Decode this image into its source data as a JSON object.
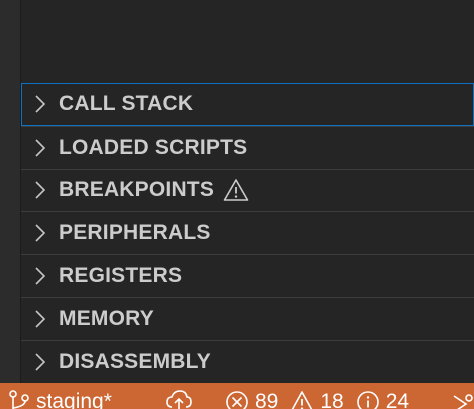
{
  "sidebar": {
    "sections": [
      {
        "label": "CALL STACK",
        "focused": true,
        "warning": false
      },
      {
        "label": "LOADED SCRIPTS",
        "focused": false,
        "warning": false
      },
      {
        "label": "BREAKPOINTS",
        "focused": false,
        "warning": true
      },
      {
        "label": "PERIPHERALS",
        "focused": false,
        "warning": false
      },
      {
        "label": "REGISTERS",
        "focused": false,
        "warning": false
      },
      {
        "label": "MEMORY",
        "focused": false,
        "warning": false
      },
      {
        "label": "DISASSEMBLY",
        "focused": false,
        "warning": false
      }
    ]
  },
  "status_bar": {
    "branch": "staging*",
    "errors": "89",
    "warnings": "18",
    "infos": "24"
  },
  "colors": {
    "sidebar_background": "#252526",
    "status_bar_background": "#cc6633",
    "focus_outline": "#0e70c0",
    "section_text": "#cccccc"
  },
  "icons": {
    "chevron": "chevron-right-icon",
    "warning": "warning-icon",
    "branch": "git-branch-icon",
    "sync": "cloud-upload-icon",
    "error": "error-icon",
    "info": "info-icon"
  }
}
